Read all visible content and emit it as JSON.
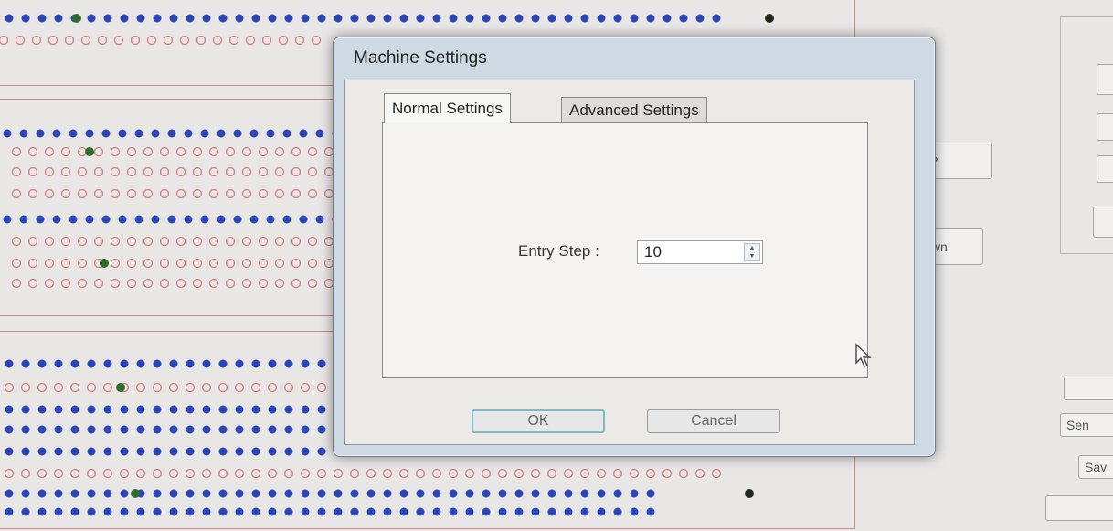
{
  "background_app": {
    "up_button_label": "UP",
    "down_button_label": "Down",
    "side_buttons": [
      "Sen",
      "Sav"
    ]
  },
  "dialog": {
    "title": "Machine Settings",
    "tabs": [
      {
        "label": "Normal Settings",
        "selected": true
      },
      {
        "label": "Advanced Settings",
        "selected": false
      }
    ],
    "entry_step": {
      "label": "Entry Step :",
      "value": "10"
    },
    "ok_label": "OK",
    "cancel_label": "Cancel"
  },
  "colors": {
    "filled_dot": "#2b45b4",
    "hollow_dot": "#d47c7c",
    "green_dot": "#2f6b2a",
    "panel_border": "#c98a8a"
  },
  "icons": [
    "cursor-arrow-icon",
    "spinner-up-icon",
    "spinner-down-icon"
  ]
}
